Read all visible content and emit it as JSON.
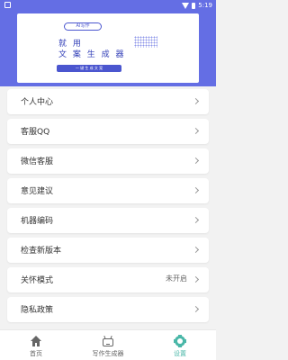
{
  "status_bar": {
    "time": "5:19"
  },
  "banner": {
    "tag": "AI写作",
    "title_line1": "就 用",
    "title_line2": "文 案 生 成 器",
    "button": "一 键 生 成 文 案"
  },
  "menu": {
    "items": [
      {
        "label": "个人中心",
        "value": ""
      },
      {
        "label": "客服QQ",
        "value": ""
      },
      {
        "label": "微信客服",
        "value": ""
      },
      {
        "label": "意见建议",
        "value": ""
      },
      {
        "label": "机器编码",
        "value": ""
      },
      {
        "label": "检查新版本",
        "value": ""
      },
      {
        "label": "关怀模式",
        "value": "未开启"
      },
      {
        "label": "隐私政策",
        "value": ""
      }
    ]
  },
  "nav": {
    "tabs": [
      {
        "label": "首页",
        "icon": "home-icon",
        "active": false
      },
      {
        "label": "写作生成器",
        "icon": "robot-icon",
        "active": false
      },
      {
        "label": "设置",
        "icon": "gear-icon",
        "active": true
      }
    ],
    "active_color": "#4ab7a8",
    "inactive_color": "#666666"
  },
  "colors": {
    "header_bg": "#646ee4",
    "page_bg": "#f2f2f2",
    "banner_accent": "#4b56cf"
  }
}
